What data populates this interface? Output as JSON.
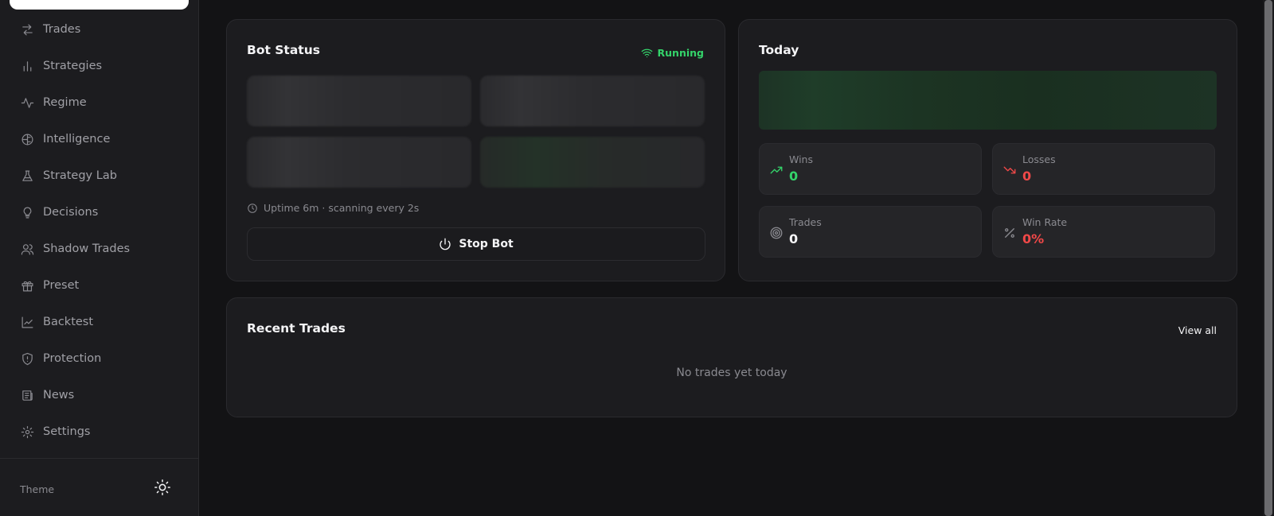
{
  "sidebar": {
    "items": [
      {
        "label": "Trades",
        "icon": "arrows-left-right-icon"
      },
      {
        "label": "Strategies",
        "icon": "bar-chart-icon"
      },
      {
        "label": "Regime",
        "icon": "activity-icon"
      },
      {
        "label": "Intelligence",
        "icon": "brain-icon"
      },
      {
        "label": "Strategy Lab",
        "icon": "flask-icon"
      },
      {
        "label": "Decisions",
        "icon": "lightbulb-icon"
      },
      {
        "label": "Shadow Trades",
        "icon": "users-icon"
      },
      {
        "label": "Preset",
        "icon": "gift-icon"
      },
      {
        "label": "Backtest",
        "icon": "line-chart-icon"
      },
      {
        "label": "Protection",
        "icon": "shield-icon"
      },
      {
        "label": "News",
        "icon": "newspaper-icon"
      },
      {
        "label": "Settings",
        "icon": "gear-icon"
      }
    ],
    "theme_label": "Theme",
    "theme_icon": "sun-icon"
  },
  "bot_status": {
    "title": "Bot Status",
    "status": "Running",
    "status_color": "#34d36a",
    "uptime_text": "Uptime 6m · scanning every 2s",
    "stop_label": "Stop Bot"
  },
  "today": {
    "title": "Today",
    "stats": [
      {
        "label": "Wins",
        "value": "0",
        "color": "#34d36a",
        "icon": "trending-up-icon"
      },
      {
        "label": "Losses",
        "value": "0",
        "color": "#f04848",
        "icon": "trending-down-icon"
      },
      {
        "label": "Trades",
        "value": "0",
        "color": "#f4f4f6",
        "icon": "target-icon"
      },
      {
        "label": "Win Rate",
        "value": "0%",
        "color": "#f04848",
        "icon": "percent-icon"
      }
    ]
  },
  "recent_trades": {
    "title": "Recent Trades",
    "view_all_label": "View all",
    "empty_message": "No trades yet today"
  }
}
